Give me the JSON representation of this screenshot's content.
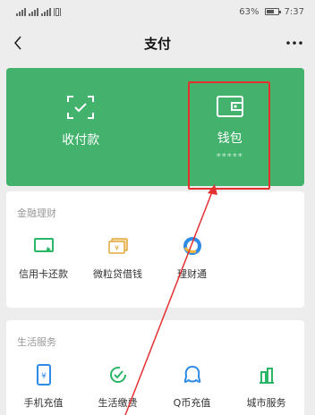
{
  "status_bar": {
    "left_text": "4G",
    "battery": "63%",
    "time": "7:37",
    "battery_level": 0.63
  },
  "nav": {
    "title": "支付",
    "back_icon": "chevron-left-icon",
    "more_icon": "more-dots-icon"
  },
  "pay_card": {
    "color": "#43b26c",
    "items": [
      {
        "label": "收付款",
        "icon": "scan-code-icon"
      },
      {
        "label": "钱包",
        "sub": "*****",
        "icon": "wallet-icon"
      }
    ]
  },
  "finance": {
    "title": "金融理财",
    "items": [
      {
        "label": "信用卡还款",
        "icon": "credit-card-icon"
      },
      {
        "label": "微粒贷借钱",
        "icon": "loan-icon"
      },
      {
        "label": "理财通",
        "icon": "wealth-icon"
      }
    ]
  },
  "life": {
    "title": "生活服务",
    "items": [
      {
        "label": "手机充值",
        "icon": "phone-topup-icon"
      },
      {
        "label": "生活缴费",
        "icon": "utilities-icon"
      },
      {
        "label": "Q币充值",
        "icon": "qq-coin-icon"
      },
      {
        "label": "城市服务",
        "icon": "city-services-icon"
      }
    ]
  },
  "annotation": {
    "color": "#e53030"
  }
}
